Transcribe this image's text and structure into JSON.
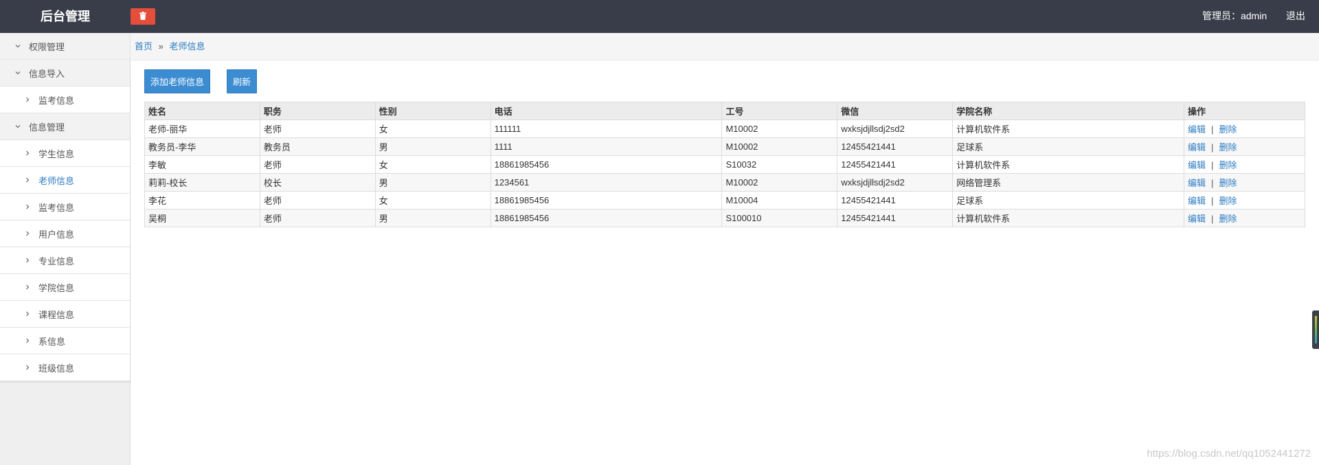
{
  "header": {
    "title": "后台管理",
    "trash_icon": "trash-icon",
    "admin_label": "管理员：admin",
    "logout_label": "退出",
    "bg_color": "#393d49",
    "trash_color": "#e64e3c"
  },
  "sidebar": {
    "items": [
      {
        "label": "权限管理",
        "level": "parent",
        "icon": "chevron-down-icon"
      },
      {
        "label": "信息导入",
        "level": "parent",
        "icon": "chevron-down-icon"
      },
      {
        "label": "监考信息",
        "level": "child",
        "icon": "chevron-right-icon"
      },
      {
        "label": "信息管理",
        "level": "parent",
        "icon": "chevron-down-icon"
      },
      {
        "label": "学生信息",
        "level": "child",
        "icon": "chevron-right-icon"
      },
      {
        "label": "老师信息",
        "level": "child",
        "icon": "chevron-right-icon",
        "active": true
      },
      {
        "label": "监考信息",
        "level": "child",
        "icon": "chevron-right-icon"
      },
      {
        "label": "用户信息",
        "level": "child",
        "icon": "chevron-right-icon"
      },
      {
        "label": "专业信息",
        "level": "child",
        "icon": "chevron-right-icon"
      },
      {
        "label": "学院信息",
        "level": "child",
        "icon": "chevron-right-icon"
      },
      {
        "label": "课程信息",
        "level": "child",
        "icon": "chevron-right-icon"
      },
      {
        "label": "系信息",
        "level": "child",
        "icon": "chevron-right-icon"
      },
      {
        "label": "班级信息",
        "level": "child",
        "icon": "chevron-right-icon"
      }
    ]
  },
  "breadcrumb": {
    "home": "首页",
    "separator": "»",
    "current": "老师信息"
  },
  "toolbar": {
    "add_label": "添加老师信息",
    "refresh_label": "刷新",
    "button_color": "#3c8cd2"
  },
  "table": {
    "columns": [
      "姓名",
      "职务",
      "性别",
      "电话",
      "工号",
      "微信",
      "学院名称",
      "操作"
    ],
    "rows": [
      [
        "老师-丽华",
        "老师",
        "女",
        "111111",
        "M10002",
        "wxksjdjllsdj2sd2",
        "计算机软件系"
      ],
      [
        "教务员-李华",
        "教务员",
        "男",
        "1111",
        "M10002",
        "12455421441",
        "足球系"
      ],
      [
        "李敏",
        "老师",
        "女",
        "18861985456",
        "S10032",
        "12455421441",
        "计算机软件系"
      ],
      [
        "莉莉-校长",
        "校长",
        "男",
        "1234561",
        "M10002",
        "wxksjdjllsdj2sd2",
        "网络管理系"
      ],
      [
        "李花",
        "老师",
        "女",
        "18861985456",
        "M10004",
        "12455421441",
        "足球系"
      ],
      [
        "吴桐",
        "老师",
        "男",
        "18861985456",
        "S100010",
        "12455421441",
        "计算机软件系"
      ]
    ],
    "actions": {
      "edit": "编辑",
      "separator": "|",
      "delete": "删除"
    }
  },
  "watermark": "https://blog.csdn.net/qq1052441272"
}
